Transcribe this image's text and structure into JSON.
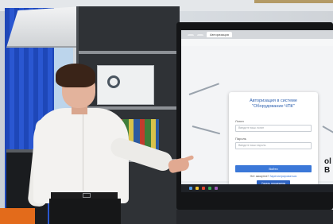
{
  "scene": {
    "description_kind": "photo",
    "screen": {
      "browser_tabs": [
        "",
        "",
        "Авторизация"
      ],
      "address": "",
      "dialog": {
        "title_line1": "Авторизация в системе",
        "title_line2": "\"Оборудование ЧПК\"",
        "login_label": "Логин",
        "login_placeholder": "Введите ваш логин",
        "password_label": "Пароль",
        "password_placeholder": "Введите ваш пароль",
        "login_button": "Войти",
        "register_prompt": "Нет аккаунта?",
        "register_link": "Зарегистрироваться",
        "rules_button": "Узнать процедуры"
      },
      "side_text": "ol B",
      "taskbar_clock": ""
    },
    "colors": {
      "blind": "#1e47b8",
      "accent_button": "#3b78d8",
      "orange_object": "#e36b1b"
    }
  }
}
